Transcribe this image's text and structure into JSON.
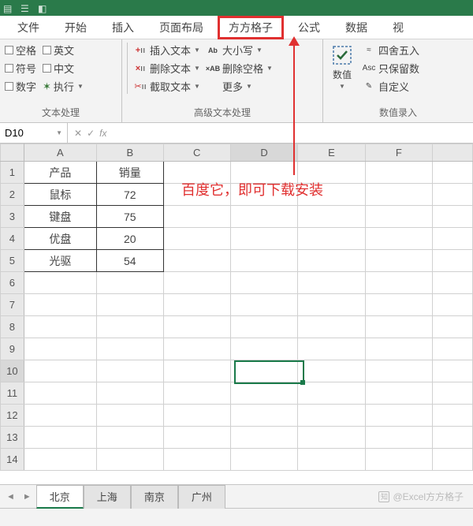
{
  "menu": {
    "tabs": [
      "文件",
      "开始",
      "插入",
      "页面布局",
      "方方格子",
      "公式",
      "数据",
      "视"
    ]
  },
  "ribbon": {
    "group1": {
      "label": "文本处理",
      "items": [
        [
          "空格",
          "英文"
        ],
        [
          "符号",
          "中文"
        ],
        [
          "数字",
          "执行"
        ]
      ]
    },
    "group2": {
      "label": "高级文本处理",
      "col1": [
        "插入文本",
        "删除文本",
        "截取文本"
      ],
      "col2": [
        "大小写",
        "删除空格",
        "更多"
      ],
      "col2_prefix": [
        "Ab",
        "×AB",
        ""
      ]
    },
    "group3": {
      "big": "数值",
      "items": [
        "四舍五入",
        "只保留数",
        "自定义"
      ],
      "label": "数值录入"
    }
  },
  "namebox": "D10",
  "annotation": "百度它，即可下载安装",
  "columns": [
    "A",
    "B",
    "C",
    "D",
    "E",
    "F"
  ],
  "rows_count": 14,
  "active_col": "D",
  "active_row": 10,
  "cells": {
    "A1": "产品",
    "B1": "销量",
    "A2": "鼠标",
    "B2": "72",
    "A3": "键盘",
    "B3": "75",
    "A4": "优盘",
    "B4": "20",
    "A5": "光驱",
    "B5": "54"
  },
  "sheet_tabs": [
    "北京",
    "上海",
    "南京",
    "广州"
  ],
  "active_sheet": "北京",
  "watermark": "Excel方方格子"
}
